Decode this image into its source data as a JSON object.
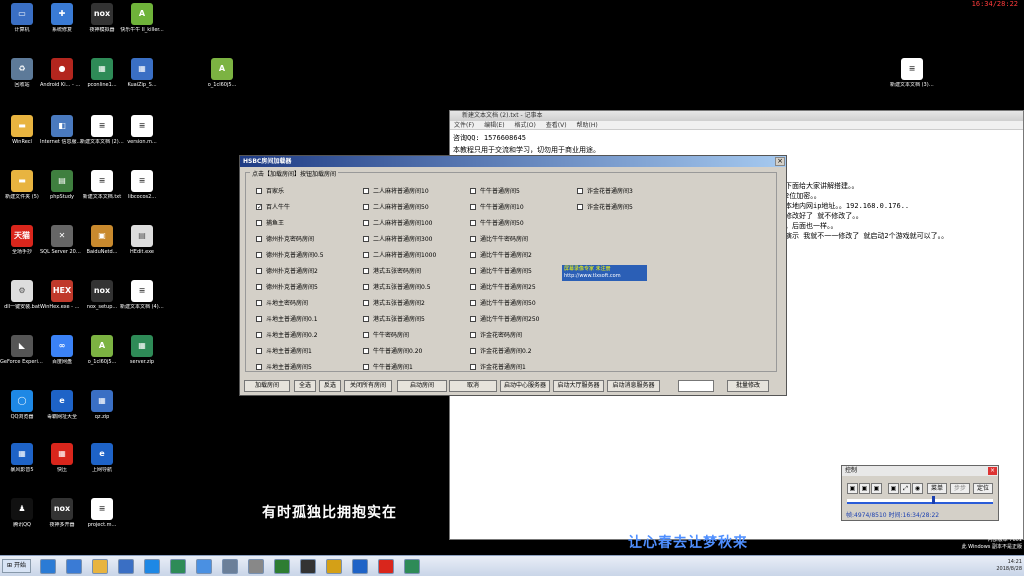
{
  "clock_top": "16:34/28:22",
  "desktop_icons": [
    {
      "label": "计算机",
      "color": "#3a6fc4",
      "glyph": "▭"
    },
    {
      "label": "系统修复",
      "color": "#3a7bd5",
      "glyph": "✚"
    },
    {
      "label": "夜神模拟器",
      "color": "#333333",
      "glyph": "nox"
    },
    {
      "label": "快乐牛牛 II_killer...",
      "color": "#6fb33a",
      "glyph": "A"
    },
    {
      "label": "回收站",
      "color": "#5d7a99",
      "glyph": "♻"
    },
    {
      "label": "Android Ki... - 快捷方式",
      "color": "#b3261e",
      "glyph": "●"
    },
    {
      "label": "pconline1...",
      "color": "#2e8b57",
      "glyph": "▦"
    },
    {
      "label": "KuaiZip_S...",
      "color": "#3a6fc4",
      "glyph": "▦"
    },
    {
      "label": "o_1cl60j5...",
      "color": "#7cb342",
      "glyph": "A"
    },
    {
      "label": "WinRecl",
      "color": "#e8b440",
      "glyph": "▬"
    },
    {
      "label": "Internet 信息服务 (I...",
      "color": "#4a7abf",
      "glyph": "◧"
    },
    {
      "label": "新建文本文档 (2).txt",
      "color": "#ffffff",
      "glyph": "≡"
    },
    {
      "label": "version.m...",
      "color": "#ffffff",
      "glyph": "≡"
    },
    {
      "label": "新建文件夹 (5)",
      "color": "#e8b440",
      "glyph": "▬"
    },
    {
      "label": "phpStudy",
      "color": "#3f7f3f",
      "glyph": "▤"
    },
    {
      "label": "新建文本文档.txt",
      "color": "#ffffff",
      "glyph": "≡"
    },
    {
      "label": "libcocos2...",
      "color": "#ffffff",
      "glyph": "≡"
    },
    {
      "label": "全场手抄",
      "color": "#d9261c",
      "glyph": "天猫"
    },
    {
      "label": "SQL Server 2014 Ma...",
      "color": "#666666",
      "glyph": "✕"
    },
    {
      "label": "BaiduNetd...",
      "color": "#c98a2e",
      "glyph": "▣"
    },
    {
      "label": "HEdit.exe",
      "color": "#dddddd",
      "glyph": "▤"
    },
    {
      "label": "dll一键安装.bat",
      "color": "#dddddd",
      "glyph": "⚙"
    },
    {
      "label": "WinHex.exe - 快捷方式",
      "color": "#c0392b",
      "glyph": "HEX"
    },
    {
      "label": "nox_setup...",
      "color": "#333333",
      "glyph": "nox"
    },
    {
      "label": "新建文本文档 (4).txt",
      "color": "#ffffff",
      "glyph": "≡"
    },
    {
      "label": "GeForce Experience",
      "color": "#555555",
      "glyph": "◣"
    },
    {
      "label": "百度网盘",
      "color": "#3b82f6",
      "glyph": "∞"
    },
    {
      "label": "o_1cl60j5...",
      "color": "#7cb342",
      "glyph": "A"
    },
    {
      "label": "server.zip",
      "color": "#2e8b57",
      "glyph": "▦"
    },
    {
      "label": "QQ浏览器",
      "color": "#1e88e5",
      "glyph": "◯"
    },
    {
      "label": "毒霸网址大全",
      "color": "#1e63c7",
      "glyph": "e"
    },
    {
      "label": "qz.zip",
      "color": "#3a6fc4",
      "glyph": "▦"
    },
    {
      "label": "暴风影音5",
      "color": "#1e63c7",
      "glyph": "▦"
    },
    {
      "label": "快压",
      "color": "#d9261c",
      "glyph": "▦"
    },
    {
      "label": "上网导航",
      "color": "#1e63c7",
      "glyph": "e"
    },
    {
      "label": "腾讯QQ",
      "color": "#111111",
      "glyph": "♟"
    },
    {
      "label": "夜神多开器",
      "color": "#333333",
      "glyph": "nox"
    },
    {
      "label": "project.m...",
      "color": "#ffffff",
      "glyph": "≡"
    },
    {
      "label": "新建文本文档 (3).txt",
      "color": "#ffffff",
      "glyph": "≡"
    }
  ],
  "notepad": {
    "title": "新建文本文档 (2).txt - 记事本",
    "menu": [
      "文件(F)",
      "编辑(E)",
      "格式(O)",
      "查看(V)",
      "帮助(H)"
    ],
    "lines": [
      "咨询QQ: 1576608645",
      "本教程只用于交流和学习，切勿用于商业用途。"
    ],
    "right_lines": [
      "下面给大家讲解搭建。。",
      "2位加密。。",
      "本地内网ip地址。。192.168.0.176..",
      "修改好了  就不修改了。。",
      "。后面也一样。。",
      "演示 我就不一一修改了 就启动2个游戏就可以了。。"
    ]
  },
  "dialog": {
    "title": "HSBC房间加载器",
    "group_label": "点击【加载房间】按钮加载房间",
    "checkboxes": [
      {
        "label": "百家乐",
        "checked": false
      },
      {
        "label": "百人牛牛",
        "checked": true
      },
      {
        "label": "捕鱼王",
        "checked": false
      },
      {
        "label": "德州扑克密码房间",
        "checked": false
      },
      {
        "label": "德州扑克普通房间0.5",
        "checked": false
      },
      {
        "label": "德州扑克普通房间2",
        "checked": false
      },
      {
        "label": "德州扑克普通房间5",
        "checked": false
      },
      {
        "label": "斗地主密码房间",
        "checked": false
      },
      {
        "label": "斗地主普通房间0.1",
        "checked": false
      },
      {
        "label": "斗地主普通房间0.2",
        "checked": false
      },
      {
        "label": "斗地主普通房间1",
        "checked": false
      },
      {
        "label": "斗地主普通房间5",
        "checked": false
      },
      {
        "label": "二人麻将普通房间10",
        "checked": false
      },
      {
        "label": "二人麻将普通房间50",
        "checked": false
      },
      {
        "label": "二人麻将普通房间100",
        "checked": false
      },
      {
        "label": "二人麻将普通房间300",
        "checked": false
      },
      {
        "label": "二人麻将普通房间1000",
        "checked": false
      },
      {
        "label": "港式五张密码房间",
        "checked": false
      },
      {
        "label": "港式五张普通房间0.5",
        "checked": false
      },
      {
        "label": "港式五张普通房间2",
        "checked": false
      },
      {
        "label": "港式五张普通房间5",
        "checked": false
      },
      {
        "label": "牛牛密码房间",
        "checked": false
      },
      {
        "label": "牛牛普通房间0.20",
        "checked": false
      },
      {
        "label": "牛牛普通房间1",
        "checked": false
      },
      {
        "label": "牛牛普通房间5",
        "checked": false
      },
      {
        "label": "牛牛普通房间10",
        "checked": false
      },
      {
        "label": "牛牛普通房间50",
        "checked": false
      },
      {
        "label": "通比牛牛密码房间",
        "checked": false
      },
      {
        "label": "通比牛牛普通房间2",
        "checked": false
      },
      {
        "label": "通比牛牛普通房间5",
        "checked": false
      },
      {
        "label": "通比牛牛普通房间25",
        "checked": false
      },
      {
        "label": "通比牛牛普通房间50",
        "checked": false
      },
      {
        "label": "通比牛牛普通房间250",
        "checked": false
      },
      {
        "label": "诈金花密码房间",
        "checked": false
      },
      {
        "label": "诈金花普通房间0.2",
        "checked": false
      },
      {
        "label": "诈金花普通房间1",
        "checked": false
      },
      {
        "label": "诈金花普通房间3",
        "checked": false
      },
      {
        "label": "诈金花普通房间5",
        "checked": false
      }
    ],
    "ad_title": "屏幕录像专家    未注册",
    "ad_url": "http://www.tlxsoft.com",
    "buttons": [
      "加载房间",
      "全选",
      "反选",
      "关闭所有房间",
      "启动房间",
      "取消",
      "启动中心服务器",
      "启动大厅服务器",
      "启动消息服务器",
      "批量修改"
    ]
  },
  "subtitles": {
    "left": "有时孤独比拥抱实在",
    "right": "让心春去让梦秋来"
  },
  "control": {
    "title": "控制",
    "menu_button": "菜单",
    "step_button": "步步",
    "locate_button": "定位",
    "status": "帧:4974/8510 时间:16:34/28:22",
    "progress": 0.58
  },
  "taskbar": {
    "start_label": "开始",
    "time": "14:21",
    "date": "2018/8/28"
  },
  "watermark": {
    "line1": "内部版本 7601",
    "line2": "此 Windows 副本不是正版"
  }
}
